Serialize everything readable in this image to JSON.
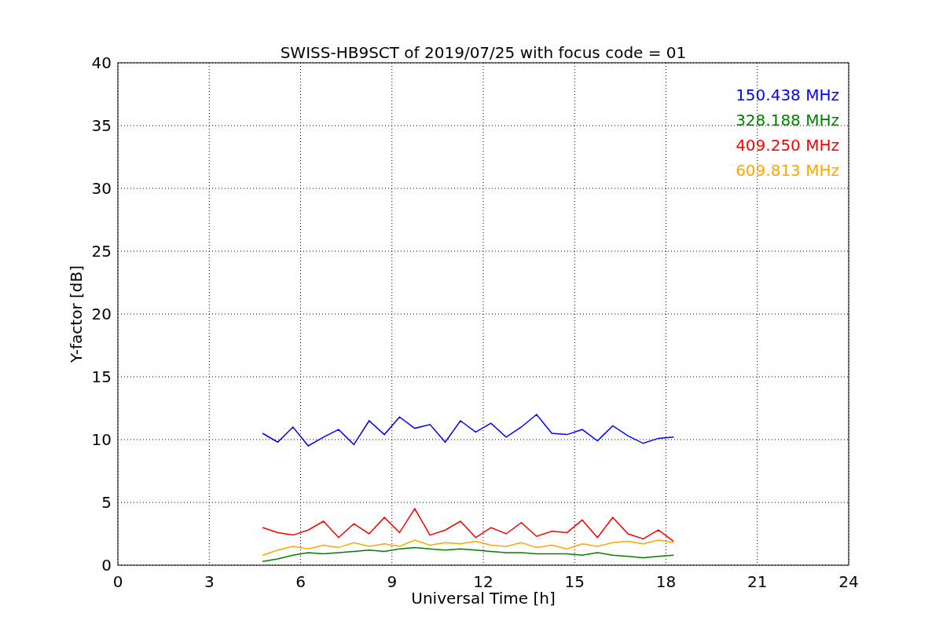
{
  "chart": {
    "chart_data": {
      "type": "line",
      "title": "SWISS-HB9SCT of 2019/07/25 with focus code = 01",
      "xlabel": "Universal Time [h]",
      "ylabel": "Y-factor [dB]",
      "x": [
        4.75,
        5.25,
        5.75,
        6.25,
        6.75,
        7.25,
        7.75,
        8.25,
        8.75,
        9.25,
        9.75,
        10.25,
        10.75,
        11.25,
        11.75,
        12.25,
        12.75,
        13.25,
        13.75,
        14.25,
        14.75,
        15.25,
        15.75,
        16.25,
        16.75,
        17.25,
        17.75,
        18.25
      ],
      "series": [
        {
          "name": "150.438 MHz",
          "color": "#0000ff",
          "values": [
            10.5,
            9.8,
            11,
            9.5,
            10.2,
            10.8,
            9.6,
            11.5,
            10.4,
            11.8,
            10.9,
            11.2,
            9.8,
            11.5,
            10.6,
            11.3,
            10.2,
            11,
            12,
            10.5,
            10.4,
            10.8,
            9.9,
            11.1,
            10.3,
            9.7,
            10.1,
            10.2
          ]
        },
        {
          "name": "328.188 MHz",
          "color": "#008000",
          "values": [
            0.3,
            0.5,
            0.8,
            1,
            0.9,
            1,
            1.1,
            1.2,
            1.1,
            1.3,
            1.4,
            1.3,
            1.2,
            1.3,
            1.2,
            1.1,
            1,
            1,
            0.9,
            0.9,
            0.9,
            0.8,
            1,
            0.8,
            0.7,
            0.6,
            0.7,
            0.8
          ]
        },
        {
          "name": "409.250 MHz",
          "color": "#ff0000",
          "values": [
            3,
            2.6,
            2.4,
            2.8,
            3.5,
            2.2,
            3.3,
            2.5,
            3.8,
            2.6,
            4.5,
            2.4,
            2.8,
            3.5,
            2.2,
            3,
            2.5,
            3.4,
            2.3,
            2.7,
            2.6,
            3.6,
            2.2,
            3.8,
            2.5,
            2.1,
            2.8,
            1.9
          ]
        },
        {
          "name": "609.813 MHz",
          "color": "#ffa500",
          "values": [
            0.8,
            1.2,
            1.5,
            1.3,
            1.6,
            1.4,
            1.8,
            1.5,
            1.7,
            1.5,
            2,
            1.6,
            1.8,
            1.7,
            1.9,
            1.6,
            1.5,
            1.8,
            1.4,
            1.6,
            1.3,
            1.7,
            1.5,
            1.8,
            1.9,
            1.7,
            2,
            1.8
          ]
        }
      ],
      "grid": true,
      "xlim": [
        0,
        24
      ],
      "ylim": [
        0,
        40
      ],
      "xticks": [
        0,
        3,
        6,
        9,
        12,
        15,
        18,
        21,
        24
      ],
      "yticks": [
        0,
        5,
        10,
        15,
        20,
        25,
        30,
        35,
        40
      ]
    }
  }
}
